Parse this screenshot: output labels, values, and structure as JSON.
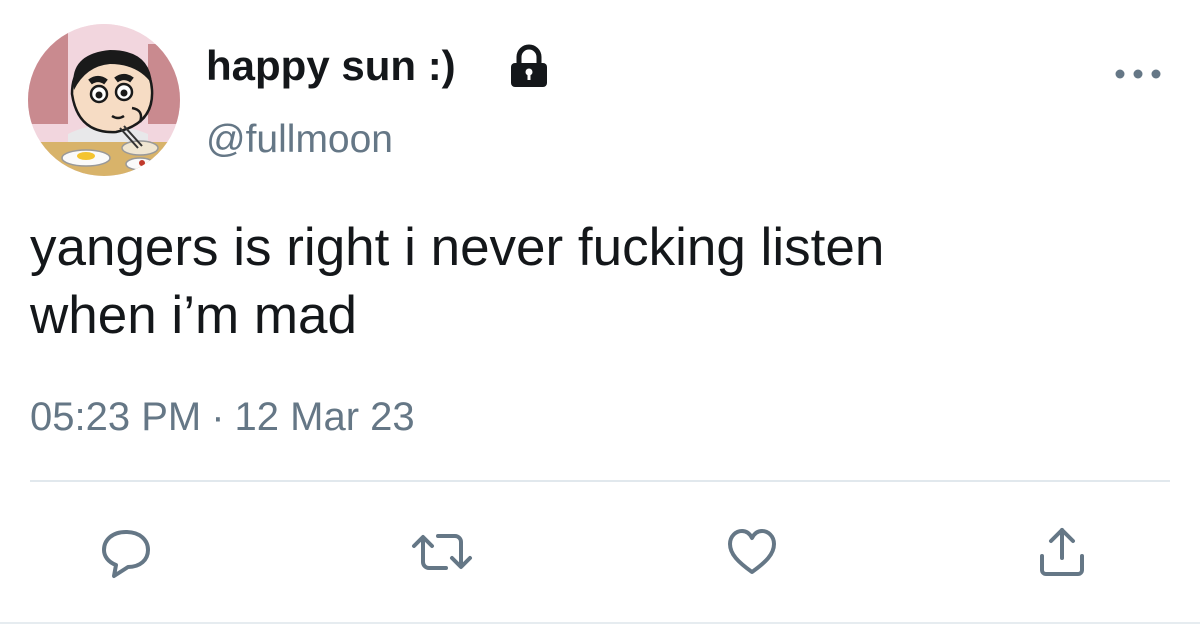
{
  "tweet": {
    "author": {
      "display_name": "happy sun :)",
      "handle": "@fullmoon",
      "protected_icon": "lock-icon",
      "avatar": "cartoon-boy-avatar"
    },
    "text_lines": [
      "yangers is right i never fucking listen",
      "when i’m mad"
    ],
    "timestamp": {
      "time": "05:23 PM",
      "separator": "·",
      "date": "12 Mar 23"
    },
    "actions": [
      {
        "icon": "reply-icon"
      },
      {
        "icon": "retweet-icon"
      },
      {
        "icon": "like-icon"
      },
      {
        "icon": "share-icon"
      }
    ],
    "more_icon": "more-icon",
    "colors": {
      "text": "#14171a",
      "secondary": "#657786",
      "divider": "#e1e8ed"
    }
  }
}
